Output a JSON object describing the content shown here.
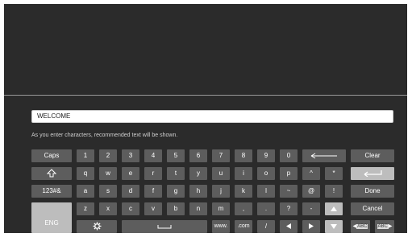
{
  "input": {
    "value": "WELCOME"
  },
  "hint": "As you enter characters, recommended text will be shown.",
  "keys": {
    "caps": "Caps",
    "n1": "1",
    "n2": "2",
    "n3": "3",
    "n4": "4",
    "n5": "5",
    "n6": "6",
    "n7": "7",
    "n8": "8",
    "n9": "9",
    "n0": "0",
    "clear": "Clear",
    "q": "q",
    "w": "w",
    "e": "e",
    "r": "r",
    "t": "t",
    "y": "y",
    "u": "u",
    "i": "i",
    "o": "o",
    "p": "p",
    "caret": "^",
    "star": "*",
    "sym": "123#&",
    "a": "a",
    "s": "s",
    "d": "d",
    "f": "f",
    "g": "g",
    "h": "h",
    "j": "j",
    "k": "k",
    "l": "l",
    "tilde": "~",
    "at": "@",
    "excl": "!",
    "done": "Done",
    "z": "z",
    "x": "x",
    "c": "c",
    "v": "v",
    "b": "b",
    "n": "n",
    "m": "m",
    "comma": ",",
    "period": ".",
    "question": "?",
    "dash": "-",
    "cancel": "Cancel",
    "eng": "ENG",
    "www": "www.",
    "com": ".com",
    "slash": "/",
    "abc": "ABC"
  },
  "icons": {
    "backspace": "left-arrow-icon",
    "shift": "shift-icon",
    "enter": "enter-icon",
    "up": "up-arrow-icon",
    "settings": "gear-icon",
    "space": "space-icon",
    "left": "left-arrow-icon",
    "right": "right-arrow-icon",
    "down": "down-arrow-icon"
  },
  "colors": {
    "screen_bg": "#2b2b2b",
    "key_bg": "#5d5d5d",
    "key_dark": "#474747",
    "key_light": "#bdbdbd"
  }
}
